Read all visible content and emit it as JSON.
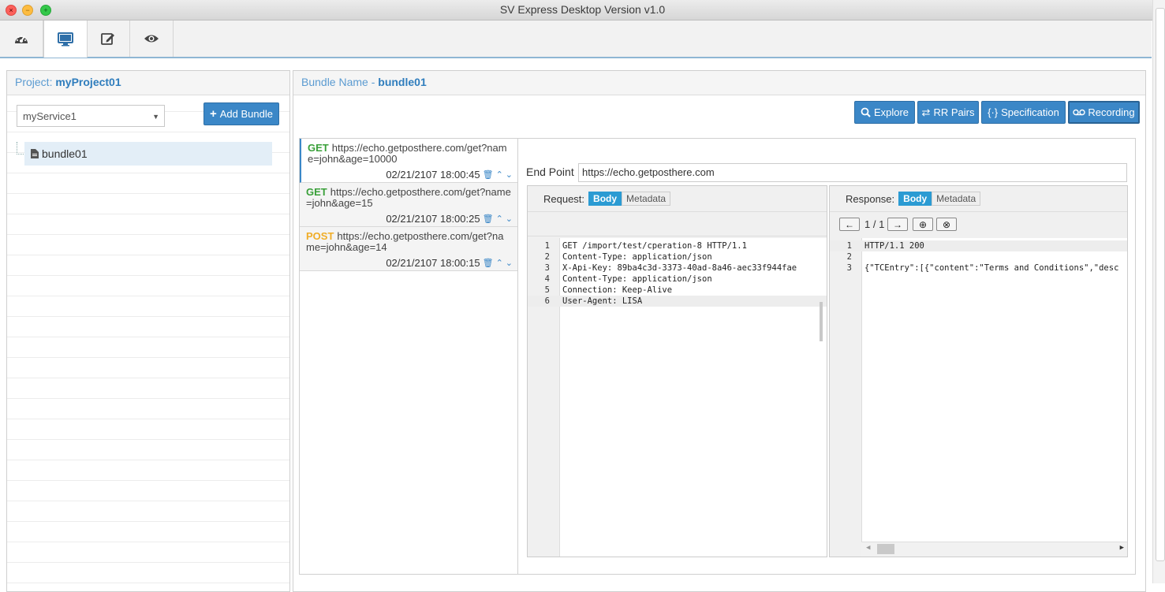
{
  "window": {
    "title": "SV Express Desktop Version v1.0"
  },
  "toolbar": {
    "icons": [
      "dashboard-icon",
      "monitor-icon",
      "edit-icon",
      "eye-icon"
    ],
    "active": "monitor-icon"
  },
  "project": {
    "label": "Project:",
    "name": "myProject01"
  },
  "service_select": {
    "value": "myService1"
  },
  "add_bundle": {
    "label": "Add Bundle"
  },
  "tree": {
    "items": [
      {
        "label": "bundle01"
      }
    ]
  },
  "bundle": {
    "label": "Bundle Name -",
    "name": "bundle01"
  },
  "actions": {
    "explore": "Explore",
    "rr_pairs": "RR Pairs",
    "specification": "Specification",
    "recording": "Recording"
  },
  "rr_list": [
    {
      "method": "GET",
      "url": "https://echo.getposthere.com/get?name=john&age=10000",
      "timestamp": "02/21/2107 18:00:45"
    },
    {
      "method": "GET",
      "url": "https://echo.getposthere.com/get?name=john&age=15",
      "timestamp": "02/21/2107 18:00:25"
    },
    {
      "method": "POST",
      "url": "https://echo.getposthere.com/get?name=john&age=14",
      "timestamp": "02/21/2107 18:00:15"
    }
  ],
  "endpoint": {
    "label": "End Point",
    "value": "https://echo.getposthere.com"
  },
  "request": {
    "label": "Request:",
    "tabs": [
      "Body",
      "Metadata"
    ],
    "lines": [
      "GET /import/test/cperation-8 HTTP/1.1",
      "Content-Type: application/json",
      "X-Api-Key: 89ba4c3d-3373-40ad-8a46-aec33f944fae",
      "Content-Type: application/json",
      "Connection: Keep-Alive",
      "User-Agent: LISA"
    ]
  },
  "response": {
    "label": "Response:",
    "tabs": [
      "Body",
      "Metadata"
    ],
    "pager": "1 / 1",
    "lines": [
      "HTTP/1.1 200",
      "",
      "{\"TCEntry\":[{\"content\":\"Terms and Conditions\",\"desc"
    ]
  },
  "colors": {
    "accent": "#3b87c7",
    "get": "#3aa03a",
    "post": "#f0ad28",
    "tab_active": "#2b9bd3"
  }
}
